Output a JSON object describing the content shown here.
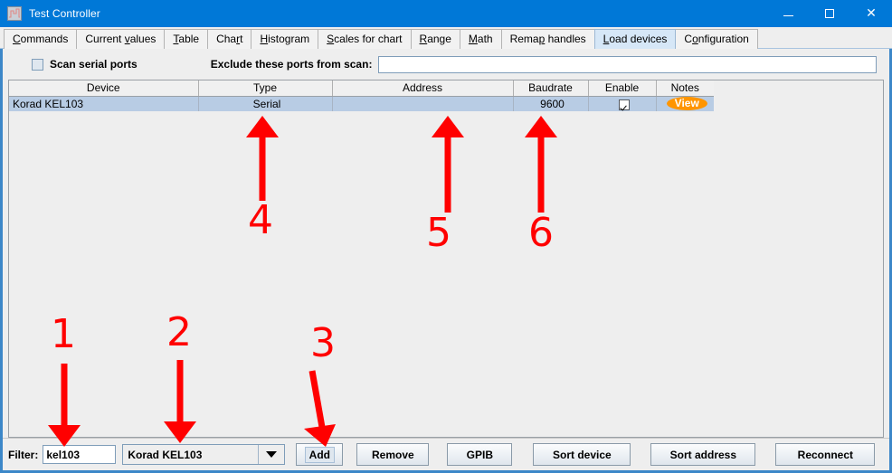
{
  "window": {
    "title": "Test Controller",
    "icon": "chart-app-icon",
    "controls": {
      "minimize": "–",
      "maximize": "□",
      "close": "✕"
    },
    "accent_color": "#0078d7",
    "border_color": "#3c87c8"
  },
  "tabs": [
    {
      "label": "Commands",
      "mnemonic": "C",
      "active": false
    },
    {
      "label": "Current values",
      "mnemonic": "v",
      "active": false
    },
    {
      "label": "Table",
      "mnemonic": "T",
      "active": false
    },
    {
      "label": "Chart",
      "mnemonic": "r",
      "active": false
    },
    {
      "label": "Histogram",
      "mnemonic": "H",
      "active": false
    },
    {
      "label": "Scales for chart",
      "mnemonic": "S",
      "active": false
    },
    {
      "label": "Range",
      "mnemonic": "R",
      "active": false
    },
    {
      "label": "Math",
      "mnemonic": "M",
      "active": false
    },
    {
      "label": "Remap handles",
      "mnemonic": "p",
      "active": false
    },
    {
      "label": "Load devices",
      "mnemonic": "L",
      "active": true
    },
    {
      "label": "Configuration",
      "mnemonic": "o",
      "active": false
    }
  ],
  "toolbar": {
    "scan_serial_ports_label": "Scan serial ports",
    "scan_serial_ports_checked": false,
    "exclude_label": "Exclude these ports from scan:",
    "exclude_value": "",
    "exclude_placeholder": ""
  },
  "table": {
    "columns": [
      "Device",
      "Type",
      "Address",
      "Baudrate",
      "Enable",
      "Notes"
    ],
    "rows": [
      {
        "device": "Korad KEL103",
        "type": "Serial",
        "address": "",
        "address_error": true,
        "baudrate": "9600",
        "enable": true,
        "notes": "View"
      }
    ],
    "selected_row_color": "#b8cce4",
    "address_error_color": "#ff7b7b",
    "notes_badge_color": "#ff9500"
  },
  "bottom": {
    "filter_label": "Filter:",
    "filter_value": "kel103",
    "filter_placeholder": "",
    "device_combo_value": "Korad KEL103",
    "buttons": {
      "add": "Add",
      "remove": "Remove",
      "gpib": "GPIB",
      "sort_device": "Sort device",
      "sort_address": "Sort address",
      "reconnect": "Reconnect"
    }
  },
  "annotations": {
    "color": "#ff0000",
    "markers": [
      {
        "number": "1",
        "target": "filter-input"
      },
      {
        "number": "2",
        "target": "device-combo"
      },
      {
        "number": "3",
        "target": "add-button"
      },
      {
        "number": "4",
        "target": "type-cell"
      },
      {
        "number": "5",
        "target": "address-cell"
      },
      {
        "number": "6",
        "target": "baudrate-cell"
      }
    ]
  }
}
